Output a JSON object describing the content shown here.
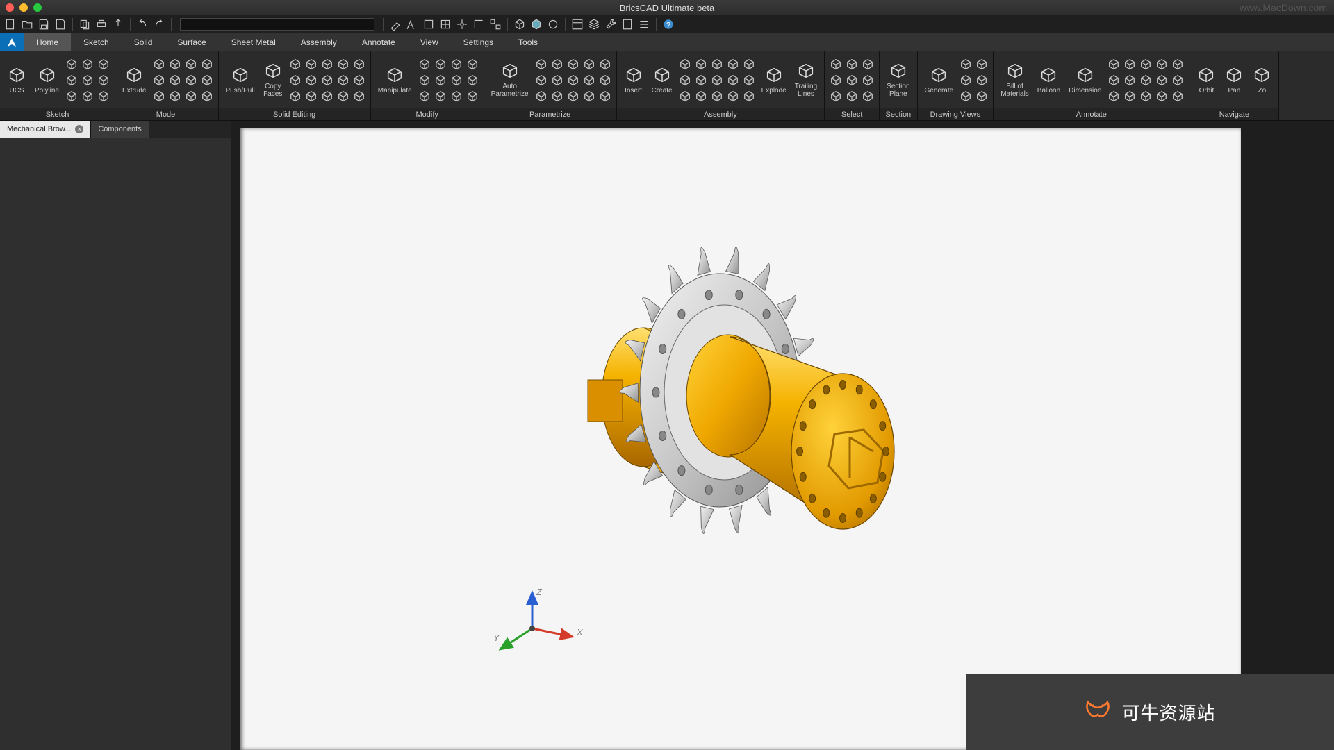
{
  "app": {
    "title": "BricsCAD Ultimate beta",
    "watermark": "www.MacDown.com"
  },
  "menubar": {
    "tabs": [
      "Home",
      "Sketch",
      "Solid",
      "Surface",
      "Sheet Metal",
      "Assembly",
      "Annotate",
      "View",
      "Settings",
      "Tools"
    ],
    "active": 0
  },
  "ribbon": {
    "panels": [
      {
        "label": "Sketch",
        "big": [
          {
            "name": "ucs",
            "label": "UCS"
          },
          {
            "name": "polyline",
            "label": "Polyline"
          }
        ],
        "small_cols": 3,
        "small_rows": 3
      },
      {
        "label": "Model",
        "big": [
          {
            "name": "extrude",
            "label": "Extrude"
          }
        ],
        "small_cols": 4,
        "small_rows": 3
      },
      {
        "label": "Solid Editing",
        "big": [
          {
            "name": "pushpull",
            "label": "Push/Pull"
          },
          {
            "name": "copyfaces",
            "label": "Copy\nFaces"
          }
        ],
        "small_cols": 5,
        "small_rows": 3
      },
      {
        "label": "Modify",
        "big": [
          {
            "name": "manipulate",
            "label": "Manipulate"
          }
        ],
        "small_cols": 4,
        "small_rows": 3
      },
      {
        "label": "Parametrize",
        "big": [
          {
            "name": "autoparam",
            "label": "Auto\nParametrize"
          }
        ],
        "small_cols": 5,
        "small_rows": 3
      },
      {
        "label": "Assembly",
        "big": [
          {
            "name": "insert",
            "label": "Insert"
          },
          {
            "name": "create",
            "label": "Create"
          }
        ],
        "small_cols": 5,
        "small_rows": 3,
        "big2": [
          {
            "name": "explode",
            "label": "Explode"
          },
          {
            "name": "trailing",
            "label": "Trailing\nLines"
          }
        ]
      },
      {
        "label": "Select",
        "big": [],
        "small_cols": 3,
        "small_rows": 3
      },
      {
        "label": "Section",
        "big": [
          {
            "name": "sectionplane",
            "label": "Section\nPlane"
          }
        ],
        "small_cols": 0,
        "small_rows": 0
      },
      {
        "label": "Drawing Views",
        "big": [
          {
            "name": "generate",
            "label": "Generate"
          }
        ],
        "small_cols": 2,
        "small_rows": 3
      },
      {
        "label": "Annotate",
        "big": [
          {
            "name": "bom",
            "label": "Bill of\nMaterials"
          },
          {
            "name": "balloon",
            "label": "Balloon"
          },
          {
            "name": "dimension",
            "label": "Dimension"
          }
        ],
        "small_cols": 5,
        "small_rows": 3
      },
      {
        "label": "Navigate",
        "big": [
          {
            "name": "orbit",
            "label": "Orbit"
          },
          {
            "name": "pan",
            "label": "Pan"
          },
          {
            "name": "zoom",
            "label": "Zo"
          }
        ],
        "small_cols": 0,
        "small_rows": 0
      }
    ]
  },
  "side_panel": {
    "tabs": [
      {
        "label": "Mechanical Brow...",
        "active": true,
        "closeable": true
      },
      {
        "label": "Components",
        "active": false,
        "closeable": false
      }
    ]
  },
  "axes": {
    "x": "X",
    "y": "Y",
    "z": "Z"
  },
  "overlay": {
    "text": "可牛资源站"
  },
  "colors": {
    "accent": "#0b6fb8",
    "gear_body": "#f0a800",
    "gear_shadow": "#c17a00",
    "sprocket": "#d0d0d0",
    "sprocket_dark": "#9a9a9a"
  }
}
